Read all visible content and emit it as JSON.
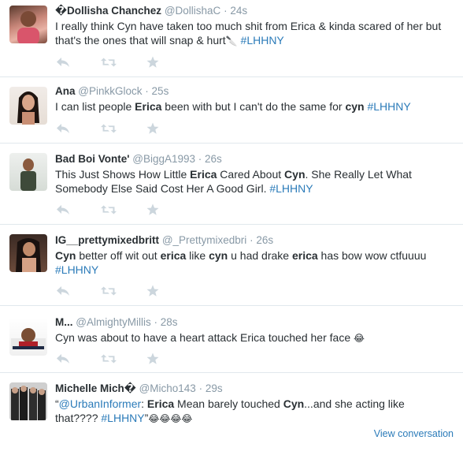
{
  "tweets": [
    {
      "fullname": "�Dollisha Chanchez",
      "username": "@DollishaC",
      "time": "24s",
      "segments": [
        {
          "t": "I really think Cyn have taken too much shit from Erica & kinda scared of her but that's the ones that will snap & hurt"
        },
        {
          "t": "🔪",
          "k": "emoji"
        },
        {
          "t": " "
        },
        {
          "t": "#LHHNY",
          "k": "hashtag"
        }
      ]
    },
    {
      "fullname": "Ana",
      "username": "@PinkkGlock",
      "time": "25s",
      "segments": [
        {
          "t": "I can list people "
        },
        {
          "t": "Erica",
          "k": "b"
        },
        {
          "t": " been with but I can't do the same for "
        },
        {
          "t": "cyn",
          "k": "b"
        },
        {
          "t": " "
        },
        {
          "t": "#LHHNY",
          "k": "hashtag"
        }
      ]
    },
    {
      "fullname": "Bad Boi Vonte'",
      "username": "@BiggA1993",
      "time": "26s",
      "segments": [
        {
          "t": "This Just Shows How Little "
        },
        {
          "t": "Erica",
          "k": "b"
        },
        {
          "t": " Cared About "
        },
        {
          "t": "Cyn",
          "k": "b"
        },
        {
          "t": ". She Really Let What Somebody Else Said Cost Her A Good Girl. "
        },
        {
          "t": "#LHHNY",
          "k": "hashtag"
        }
      ]
    },
    {
      "fullname": "IG__prettymixedbritt",
      "username": "@_Prettymixedbri",
      "time": "26s",
      "segments": [
        {
          "t": "Cyn",
          "k": "b"
        },
        {
          "t": " better off wit out "
        },
        {
          "t": "erica",
          "k": "b"
        },
        {
          "t": " like "
        },
        {
          "t": "cyn",
          "k": "b"
        },
        {
          "t": " u had drake "
        },
        {
          "t": "erica",
          "k": "b"
        },
        {
          "t": " has bow wow ctfuuuu "
        },
        {
          "t": "#LHHNY",
          "k": "hashtag"
        }
      ]
    },
    {
      "fullname": "M...",
      "username": "@AlmightyMillis",
      "time": "28s",
      "segments": [
        {
          "t": "Cyn was about to have a heart attack Erica touched her face "
        },
        {
          "t": "😂",
          "k": "emoji"
        }
      ]
    },
    {
      "fullname": "Michelle Mich�",
      "username": "@Micho143",
      "time": "29s",
      "segments": [
        {
          "t": "“"
        },
        {
          "t": "@UrbanInformer",
          "k": "mention"
        },
        {
          "t": ": "
        },
        {
          "t": "Erica",
          "k": "b"
        },
        {
          "t": " Mean barely touched "
        },
        {
          "t": "Cyn",
          "k": "b"
        },
        {
          "t": "...and she acting like that???? "
        },
        {
          "t": "#LHHNY",
          "k": "hashtag"
        },
        {
          "t": "”"
        },
        {
          "t": "😂😂😂😂",
          "k": "emoji"
        }
      ],
      "view_conversation": "View conversation"
    }
  ],
  "separator": "·",
  "icons": {
    "reply": "reply-icon",
    "retweet": "retweet-icon",
    "favorite": "star-icon"
  },
  "colors": {
    "link": "#2b7bb9",
    "meta": "#8899a6",
    "icon": "#ccd6dd",
    "border": "#e1e8ed"
  }
}
